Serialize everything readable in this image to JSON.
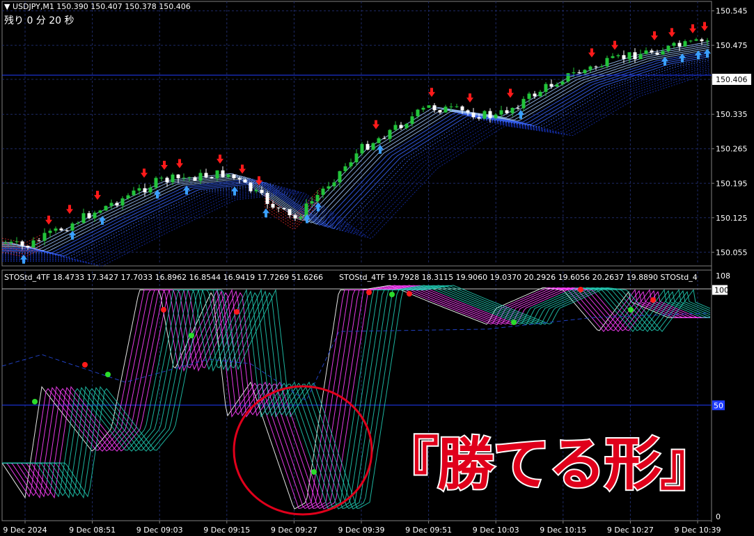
{
  "window": {
    "symbol_line": "USDJPY,M1  150.390 150.407 150.378 150.406",
    "countdown": "残り  0 分  20 秒"
  },
  "indicator_header": {
    "left": "STOStd_4TF 18.4733 17.3427 17.7033 16.8962 16.8544 16.9419 17.7269 51.6266",
    "right": "STOStd_4TF 19.7928 18.3115 19.9060 19.0370 20.2926 19.6056 20.2637 19.8890  STOStd_4"
  },
  "price_axis": {
    "ticks": [
      "150.545",
      "150.475",
      "150.406",
      "150.335",
      "150.265",
      "150.195",
      "150.125",
      "150.055"
    ],
    "current_price": "150.406"
  },
  "indicator_axis": {
    "ticks": [
      "108",
      "100",
      "50",
      "0"
    ]
  },
  "time_axis": {
    "ticks": [
      "9 Dec 2024",
      "9 Dec 08:51",
      "9 Dec 09:03",
      "9 Dec 09:15",
      "9 Dec 09:27",
      "9 Dec 09:39",
      "9 Dec 09:51",
      "9 Dec 10:03",
      "9 Dec 10:15",
      "9 Dec 10:27",
      "9 Dec 10:39"
    ]
  },
  "annotation": {
    "text": "『勝てる形』"
  },
  "colors": {
    "background": "#000000",
    "grid": "#1e2a66",
    "bull_candle": "#22c43a",
    "bear_candle": "#ffffff",
    "up_arrow": "#3aa0ff",
    "down_arrow": "#ff1a1a",
    "stoch_fast": "#ff40ff",
    "stoch_slow": "#20c8b0",
    "circle": "#e0001b",
    "level_line": "#1f3cff"
  },
  "chart_data": [
    {
      "type": "line",
      "title": "",
      "series_kind": "price-with-moving-average-ribbon",
      "x": [
        "9 Dec 2024",
        "9 Dec 08:51",
        "9 Dec 09:03",
        "9 Dec 09:15",
        "9 Dec 09:27",
        "9 Dec 09:39",
        "9 Dec 09:51",
        "9 Dec 10:03",
        "9 Dec 10:15",
        "9 Dec 10:27",
        "9 Dec 10:39"
      ],
      "series": [
        {
          "values": [
            150.065,
            150.135,
            150.2,
            150.215,
            150.12,
            150.265,
            150.35,
            150.33,
            150.41,
            150.455,
            150.48
          ]
        }
      ],
      "ylim": [
        150.03,
        150.56
      ],
      "current_price": 150.406
    },
    {
      "type": "line",
      "title": "",
      "indicator": "STOStd_4TF",
      "x": [
        "9 Dec 2024",
        "9 Dec 08:51",
        "9 Dec 09:03",
        "9 Dec 09:15",
        "9 Dec 09:27",
        "9 Dec 09:39",
        "9 Dec 09:51",
        "9 Dec 10:03",
        "9 Dec 10:15",
        "9 Dec 10:27",
        "9 Dec 10:39"
      ],
      "series": [
        {
          "values": [
            10,
            30,
            100,
            45,
            5,
            100,
            95,
            92,
            100,
            95,
            88
          ]
        }
      ],
      "ylim": [
        0,
        108
      ],
      "levels": [
        100,
        50
      ],
      "header_values_left": [
        18.4733,
        17.3427,
        17.7033,
        16.8962,
        16.8544,
        16.9419,
        17.7269,
        51.6266
      ],
      "header_values_right": [
        19.7928,
        18.3115,
        19.906,
        19.037,
        20.2926,
        19.6056,
        20.2637,
        19.889
      ]
    }
  ]
}
